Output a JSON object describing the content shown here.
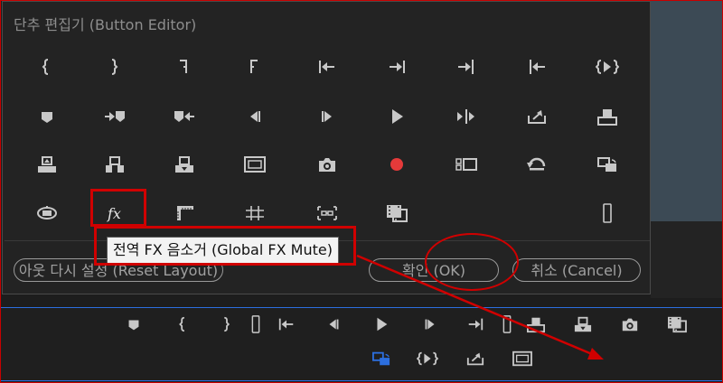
{
  "dialog": {
    "title": "단추 편집기 (Button Editor)",
    "buttons": [
      {
        "icon": "mark-in-icon"
      },
      {
        "icon": "mark-out-icon"
      },
      {
        "icon": "mark-clip-in-icon"
      },
      {
        "icon": "mark-clip-out-icon"
      },
      {
        "icon": "go-to-in-icon"
      },
      {
        "icon": "go-to-out-icon"
      },
      {
        "icon": "go-to-next-edit-icon"
      },
      {
        "icon": "go-to-previous-edit-icon"
      },
      {
        "icon": "play-in-to-out-icon"
      },
      {
        "icon": "add-marker-icon"
      },
      {
        "icon": "go-to-next-marker-icon"
      },
      {
        "icon": "go-to-previous-marker-icon"
      },
      {
        "icon": "step-back-icon"
      },
      {
        "icon": "step-forward-icon"
      },
      {
        "icon": "play-icon"
      },
      {
        "icon": "play-around-icon"
      },
      {
        "icon": "export-frame-out-icon"
      },
      {
        "icon": "insert-icon"
      },
      {
        "icon": "lift-icon"
      },
      {
        "icon": "extract-icon"
      },
      {
        "icon": "overwrite-icon"
      },
      {
        "icon": "safe-margins-icon"
      },
      {
        "icon": "camera-icon"
      },
      {
        "icon": "record-icon"
      },
      {
        "icon": "multi-camera-icon"
      },
      {
        "icon": "loop-icon"
      },
      {
        "icon": "toggle-proxies-icon"
      },
      {
        "icon": "vr-video-icon"
      },
      {
        "icon": "global-fx-mute-icon"
      },
      {
        "icon": "show-rulers-icon"
      },
      {
        "icon": "show-guides-icon"
      },
      {
        "icon": "snap-guides-icon"
      },
      {
        "icon": "filmstrip-icon"
      },
      {
        "icon": "spacer-icon"
      }
    ],
    "tooltip": "전역 FX 음소거 (Global FX Mute)",
    "reset_label": "아웃 다시 설정 (Reset Layout)",
    "ok_label": "확인 (OK)",
    "cancel_label": "취소 (Cancel)"
  },
  "transport_bar": {
    "row1": [
      "add-marker-icon",
      "mark-in-icon",
      "mark-out-icon",
      "spacer-icon",
      "go-to-in-icon",
      "step-back-icon",
      "play-icon",
      "step-forward-icon",
      "go-to-out-icon",
      "spacer-icon",
      "insert-icon",
      "overwrite-icon",
      "camera-icon",
      "filmstrip-icon"
    ],
    "row2": [
      "toggle-proxies-icon",
      "play-in-to-out-icon",
      "export-frame-out-icon",
      "safe-margins-icon"
    ]
  },
  "colors": {
    "accent": "#2c6fdf",
    "highlight": "#d00000",
    "record": "#e53a3a"
  }
}
